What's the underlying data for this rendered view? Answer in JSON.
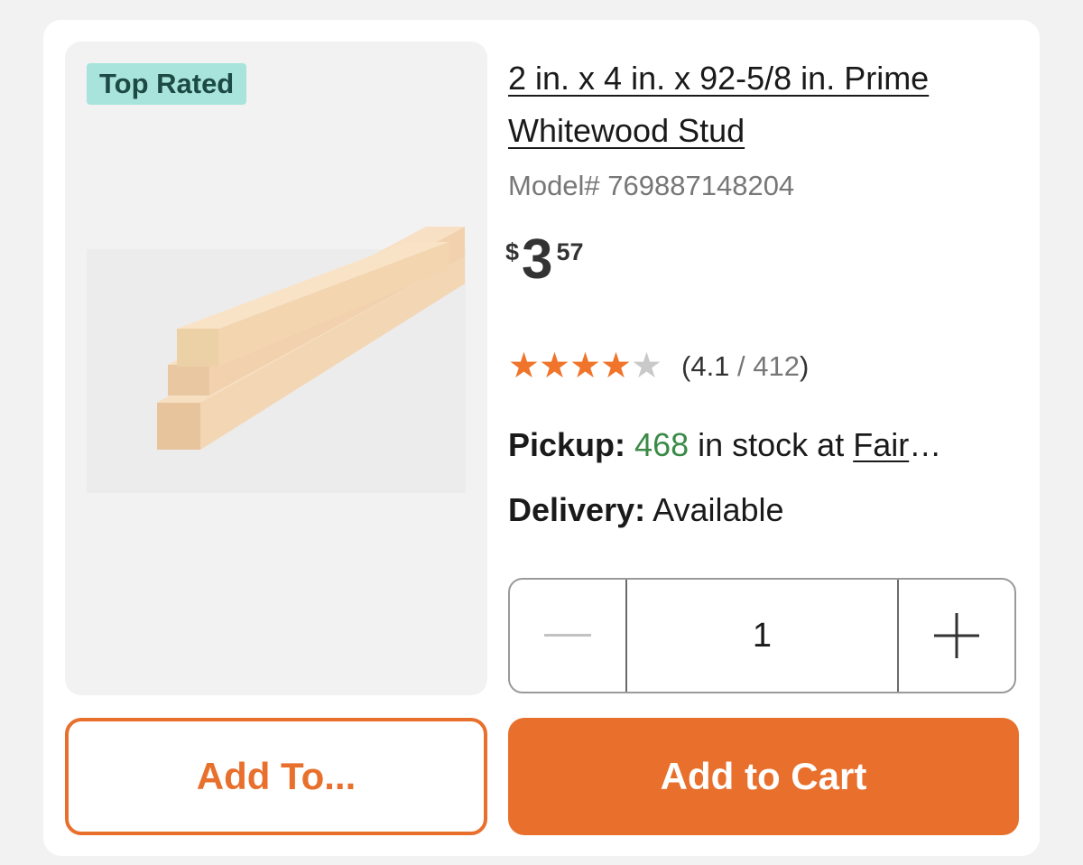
{
  "product": {
    "badge": "Top Rated",
    "title": "2 in. x 4 in. x 92-5/8 in. Prime Whitewood Stud",
    "model": "Model# 769887148204",
    "price": {
      "currency": "$",
      "dollars": "3",
      "cents": "57"
    },
    "rating": {
      "value": 4.1,
      "max": 5,
      "stars_filled": 4,
      "open": "(",
      "value_text": "4.1",
      "sep": " / ",
      "count": "412",
      "close": ")"
    },
    "pickup": {
      "label": "Pickup:",
      "quantity": "468",
      "middle": " in stock at ",
      "store": "Fair",
      "ellipsis": "…"
    },
    "delivery": {
      "label": "Delivery:",
      "status": "Available"
    }
  },
  "quantity": {
    "value": "1",
    "minus_icon": "minus-icon",
    "plus_icon": "plus-icon"
  },
  "actions": {
    "add_to_label": "Add To...",
    "add_to_cart_label": "Add to Cart"
  },
  "colors": {
    "accent": "#e8702c",
    "badge_bg": "#a8e4dc",
    "stock_green": "#3b8a47",
    "star": "#f0742a"
  }
}
